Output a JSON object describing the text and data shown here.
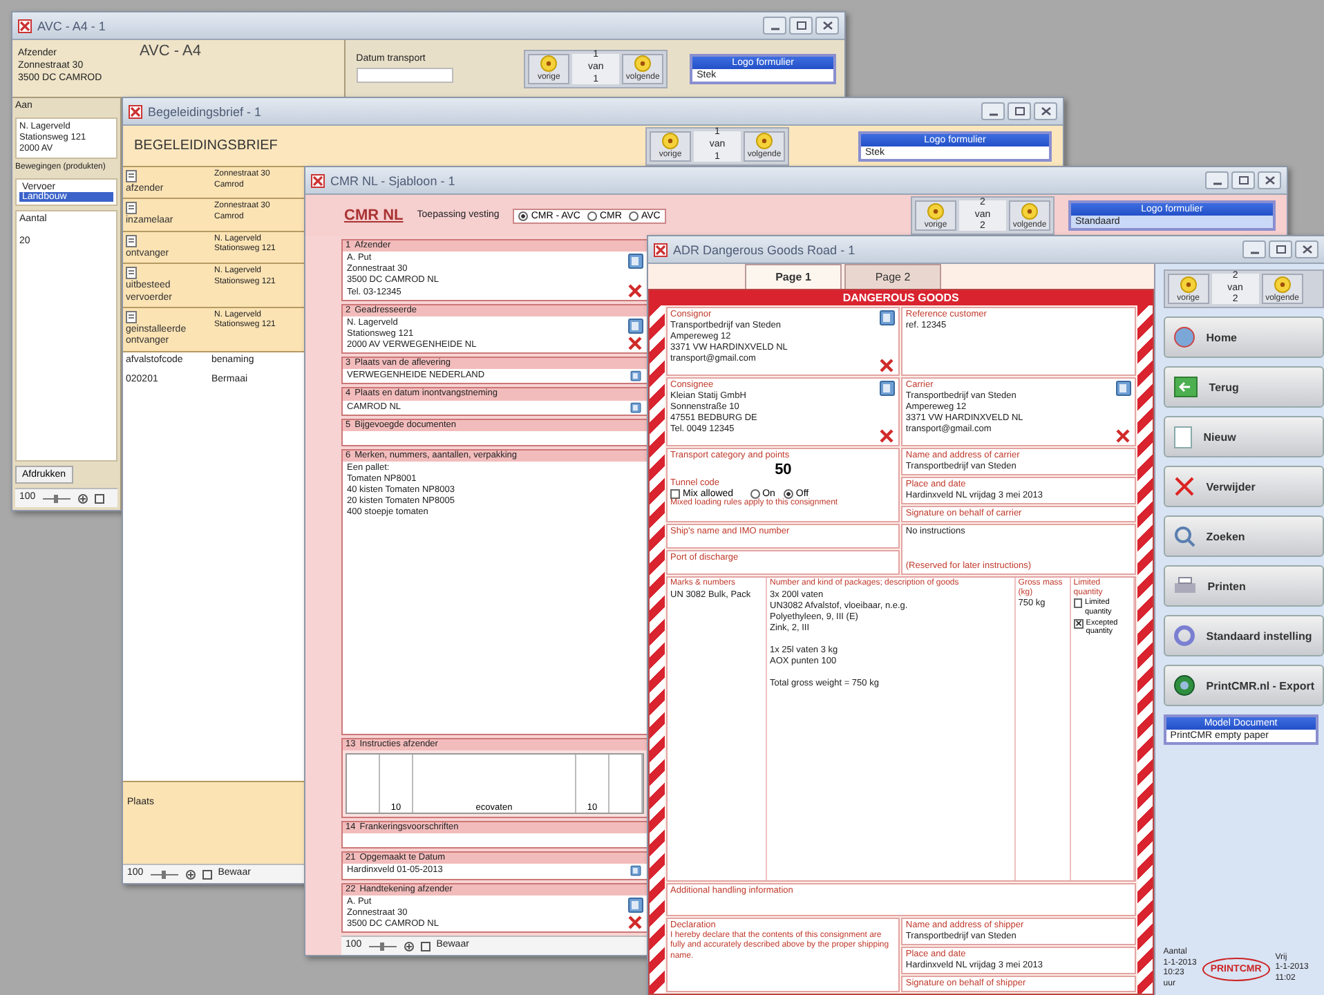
{
  "avc": {
    "title": "AVC - A4 - 1",
    "heading": "AVC - A4",
    "sender_label": "Afzender",
    "sender_lines": [
      "Zonnestraat 30",
      "3500 DC CAMROD"
    ],
    "date_label": "Datum transport",
    "pager": {
      "prev": "vorige",
      "current": "1",
      "of": "van",
      "total": "1",
      "next": "volgende"
    },
    "logo_list": {
      "header": "Logo formulier",
      "items": [
        {
          "label": "Stek",
          "selected": false
        }
      ]
    },
    "recipient_label": "Aan",
    "recipient_lines": [
      "N. Lagerveld",
      "Stationsweg 121",
      "2000 AV"
    ],
    "movements_label": "Bewegingen (produkten)",
    "movements": [
      {
        "label": "Vervoer",
        "selected": false
      },
      {
        "label": "Landbouw",
        "selected": true
      }
    ],
    "column_header": "Aantal",
    "row_value": "20",
    "print_button": "Afdrukken",
    "zoom": "100"
  },
  "begeleidingsbrief": {
    "title": "Begeleidingsbrief - 1",
    "heading": "BEGELEIDINGSBRIEF",
    "pager": {
      "prev": "vorige",
      "current": "1",
      "of": "van",
      "total": "1",
      "next": "volgende"
    },
    "logo_list": {
      "header": "Logo formulier",
      "items": [
        {
          "label": "Stek",
          "selected": false
        }
      ]
    },
    "parties": [
      {
        "label": "afzender",
        "lines": [
          "Zonnestraat 30",
          "Camrod"
        ]
      },
      {
        "label": "inzamelaar",
        "lines": [
          "Zonnestraat 30",
          "Camrod"
        ]
      },
      {
        "label": "ontvanger",
        "lines": [
          "N. Lagerveld",
          "Stationsweg 121"
        ]
      },
      {
        "label": "uitbesteed vervoerder",
        "lines": [
          "N. Lagerveld",
          "Stationsweg 121"
        ]
      },
      {
        "label": "geinstalleerde ontvanger",
        "lines": [
          "N. Lagerveld",
          "Stationsweg 121"
        ]
      }
    ],
    "waste_headers": [
      "afvalstofcode",
      "benaming"
    ],
    "waste_rows": [
      [
        "020201",
        "Bermaai"
      ]
    ],
    "place_label": "Plaats",
    "zoom": "100",
    "save": "Bewaar"
  },
  "cmr": {
    "title": "CMR NL - Sjabloon - 1",
    "heading": "CMR NL",
    "mode_label": "Toepassing vesting",
    "modes": [
      {
        "label": "CMR - AVC",
        "selected": true
      },
      {
        "label": "CMR",
        "selected": false
      },
      {
        "label": "AVC",
        "selected": false
      }
    ],
    "pager": {
      "prev": "vorige",
      "current": "2",
      "of": "van",
      "total": "2",
      "next": "volgende"
    },
    "logo_list": {
      "header": "Logo formulier",
      "items": [
        {
          "label": "Standaard",
          "selected": true
        }
      ]
    },
    "boxes": [
      {
        "kind": "address",
        "number": "1",
        "label": "Afzender",
        "lines": [
          "A. Put",
          "Zonnestraat 30",
          "3500 DC CAMROD  NL",
          "Tel. 03-12345"
        ]
      },
      {
        "kind": "address",
        "number": "2",
        "label": "Geadresseerde",
        "lines": [
          "N. Lagerveld",
          "Stationsweg 121",
          "2000 AV VERWEGENHEIDE  NL"
        ]
      },
      {
        "kind": "place",
        "number": "3",
        "label": "Plaats van de aflevering",
        "lines": [
          "VERWEGENHEIDE  NEDERLAND"
        ]
      },
      {
        "kind": "place",
        "number": "4",
        "label": "Plaats en datum inontvangstneming",
        "lines": [
          "CAMROD  NL"
        ]
      },
      {
        "kind": "text",
        "number": "5",
        "label": "Bijgevoegde documenten"
      },
      {
        "kind": "goods",
        "number": "6",
        "label": "Merken, nummers, aantallen, verpakking",
        "lines": [
          "Een pallet:",
          "Tomaten NP8001",
          "40 kisten Tomaten NP8003",
          "20 kisten Tomaten NP8005",
          "400 stoepje tomaten"
        ]
      },
      {
        "kind": "table",
        "number": "13",
        "label": "Instructies afzender",
        "lines": [
          "10",
          "ecovaten",
          "10"
        ]
      },
      {
        "kind": "text",
        "number": "14",
        "label": "Frankeringsvoorschriften"
      },
      {
        "kind": "place",
        "number": "21",
        "label": "Opgemaakt te   Datum",
        "lines": [
          "Hardinxveld     01-05-2013"
        ]
      },
      {
        "kind": "address",
        "number": "22",
        "label": "Handtekening afzender",
        "lines": [
          "A. Put",
          "Zonnestraat 30",
          "3500 DC CAMROD  NL"
        ]
      }
    ],
    "zoom": "100",
    "save": "Bewaar"
  },
  "adr": {
    "title": "ADR Dangerous Goods Road - 1",
    "tabs": [
      {
        "label": "Page 1",
        "selected": true
      },
      {
        "label": "Page 2",
        "selected": false
      }
    ],
    "banner": "DANGEROUS GOODS",
    "cells": [
      {
        "label": "Consignor",
        "lines": [
          "Transportbedrijf van Steden",
          "Ampereweg 12",
          "3371 VW HARDINXVELD  NL",
          "transport@gmail.com"
        ],
        "tools": true
      },
      {
        "label": "Reference customer",
        "lines": [
          "ref. 12345"
        ],
        "tools": false
      },
      {
        "label": "Consignee",
        "lines": [
          "Kleian Statij GmbH",
          "Sonnenstraße 10",
          "47551 BEDBURG  DE",
          "Tel. 0049 12345"
        ],
        "tools": true
      },
      {
        "label": "Carrier",
        "lines": [
          "Transportbedrijf van Steden",
          "Ampereweg 12",
          "3371 VW HARDINXVELD  NL",
          "transport@gmail.com"
        ],
        "tools": true
      }
    ],
    "category": {
      "label": "Transport category and points",
      "value": "50"
    },
    "tunnel_label": "Tunnel code",
    "mix": {
      "label": "Mix allowed",
      "checked": false
    },
    "onoff": [
      {
        "label": "On",
        "selected": false
      },
      {
        "label": "Off",
        "selected": true
      }
    ],
    "mix_note": "Mixed loading rules apply to this consignment",
    "right_cells": [
      {
        "label": "Name and address of carrier",
        "value": "Transportbedrijf van Steden"
      },
      {
        "label": "Place and date",
        "value": "Hardinxveld  NL     vrijdag 3 mei 2013"
      },
      {
        "label": "Signature on behalf of carrier"
      }
    ],
    "ship_label": "Ship's name and IMO number",
    "port_label": "Port of discharge",
    "instructions": "No instructions",
    "instructions_note": "(Reserved for later instructions)",
    "goods_headers": [
      "Marks & numbers",
      "Number and kind of packages; description of goods",
      "Gross mass (kg)",
      "Limited quantity"
    ],
    "goods_mark": "UN 3082 Bulk, Pack",
    "goods_groups": [
      [
        "3x 200l vaten",
        "UN3082 Afvalstof, vloeibaar, n.e.g.",
        "Polyethyleen, 9, III (E)",
        "Zink, 2, III"
      ],
      [
        "1x 25l vaten      3 kg",
        "AOX punten 100"
      ],
      [
        "Total gross weight = 750 kg"
      ]
    ],
    "goods_mass": [
      "750 kg"
    ],
    "quantity_options": [
      {
        "label": "Limited quantity",
        "checked": false
      },
      {
        "label": "Excepted quantity",
        "checked": true
      }
    ],
    "handling_label": "Additional handling information",
    "declaration_label": "Declaration",
    "declaration_text": "I hereby declare that the contents of this consignment are fully and accurately described above by the proper shipping name.",
    "bottom_cells": [
      {
        "label": "Name and address of shipper",
        "value": "Transportbedrijf van Steden"
      },
      {
        "label": "Place and date",
        "value": "Hardinxveld  NL     vrijdag 3 mei 2013"
      },
      {
        "label": "Signature on behalf of shipper"
      }
    ],
    "pager": {
      "prev": "vorige",
      "current": "2",
      "of": "van",
      "total": "2",
      "next": "volgende"
    },
    "buttons": [
      {
        "kind": "home",
        "label": "Home"
      },
      {
        "kind": "back",
        "label": "Terug"
      },
      {
        "kind": "new",
        "label": "Nieuw"
      },
      {
        "kind": "delete",
        "label": "Verwijder"
      },
      {
        "kind": "search",
        "label": "Zoeken"
      },
      {
        "kind": "print",
        "label": "Printen"
      },
      {
        "kind": "reset",
        "label": "Standaard instelling"
      },
      {
        "kind": "export",
        "label": "PrintCMR.nl - Export"
      }
    ],
    "model_list": {
      "header": "Model Document",
      "items": [
        {
          "label": "PrintCMR empty paper",
          "selected": false
        }
      ]
    },
    "footer_left": [
      "Aantal",
      "1-1-2013",
      "10:23",
      "uur"
    ],
    "logo": "PRINTCMR",
    "footer_right": [
      "Vrij",
      "1-1-2013",
      "11:02"
    ]
  }
}
